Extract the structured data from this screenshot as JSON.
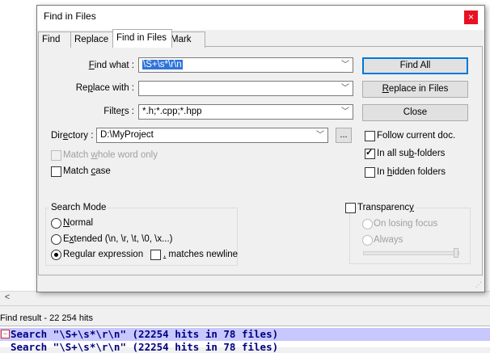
{
  "dialog": {
    "title": "Find in Files",
    "close_glyph": "×",
    "tabs": [
      {
        "label": "Find"
      },
      {
        "label": "Replace"
      },
      {
        "label": "Find in Files",
        "active": true
      },
      {
        "label": "Mark"
      }
    ],
    "find_what": {
      "label_u": "F",
      "label_rest": "ind what :",
      "value": "\\S+\\s*\\r\\n"
    },
    "replace_with": {
      "label_pre": "Re",
      "label_u": "p",
      "label_rest": "lace with :",
      "value": ""
    },
    "filters": {
      "label_pre": "Filte",
      "label_u": "r",
      "label_rest": "s :",
      "value": "*.h;*.cpp;*.hpp"
    },
    "directory": {
      "label_pre": "Dir",
      "label_u": "e",
      "label_rest": "ctory :",
      "value": "D:\\MyProject",
      "browse_label": "..."
    },
    "buttons": {
      "find_all": "Find All",
      "replace_in_files_u": "R",
      "replace_in_files_rest": "eplace in Files",
      "close": "Close"
    },
    "options": {
      "follow_current_doc": {
        "label": "Follow current doc.",
        "checked": false
      },
      "in_all_subfolders": {
        "label_pre": "In all su",
        "label_u": "b",
        "label_rest": "-folders",
        "checked": true
      },
      "in_hidden_folders": {
        "label_pre": "In ",
        "label_u": "h",
        "label_rest": "idden folders",
        "checked": false
      },
      "match_whole_word": {
        "label_pre": "Match ",
        "label_u": "w",
        "label_rest": "hole word only",
        "checked": false,
        "disabled": true
      },
      "match_case": {
        "label_pre": "Match ",
        "label_u": "c",
        "label_rest": "ase",
        "checked": false
      }
    },
    "search_mode": {
      "title": "Search Mode",
      "normal": {
        "label_u": "N",
        "label_rest": "ormal",
        "selected": false
      },
      "extended": {
        "label_pre": "E",
        "label_u": "x",
        "label_rest": "tended (\\n, \\r, \\t, \\0, \\x...)",
        "selected": false
      },
      "regex": {
        "label_pre": "Re",
        "label_u": "g",
        "label_rest": "ular expression",
        "selected": true
      },
      "matches_newline": {
        "label_u": ".",
        "label_rest": " matches newline",
        "checked": false
      }
    },
    "transparency": {
      "label_pre": "Transparenc",
      "label_u": "y",
      "label_rest": "",
      "checked": false,
      "on_losing_focus": "On losing focus",
      "always": "Always",
      "level": 1.0
    }
  },
  "background": {
    "scroll_left_glyph": "<",
    "find_result_title": "Find result - 22 254 hits",
    "result_line_1": "Search \"\\S+\\s*\\r\\n\" (22254 hits in 78 files)",
    "result_line_2": "Search \"\\S+\\s*\\r\\n\" (22254 hits in 78 files)"
  },
  "colors": {
    "accent": "#0078d7",
    "selection": "#3074d8",
    "result_highlight": "#c8c8ff",
    "result_text": "#000080",
    "close_red": "#e81123"
  }
}
